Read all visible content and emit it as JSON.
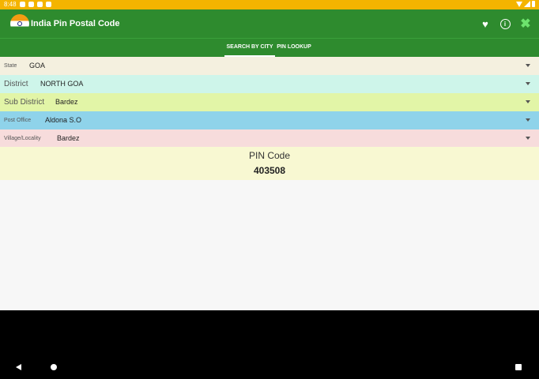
{
  "status_bar": {
    "time": "8:48"
  },
  "app": {
    "title": "India Pin Postal Code",
    "logo_icon": "india-flag-pin-icon",
    "actions": {
      "favorite_icon": "heart-icon",
      "info_icon": "info-icon",
      "close_icon": "close-x-icon"
    }
  },
  "tabs": [
    {
      "label": "SEARCH BY CITY",
      "active": true
    },
    {
      "label": "PIN LOOKUP",
      "active": false
    }
  ],
  "fields": [
    {
      "label": "State",
      "value": "GOA",
      "bg": "#f4f0df"
    },
    {
      "label": "District",
      "value": "NORTH GOA",
      "bg": "#cef5ea"
    },
    {
      "label": "Sub District",
      "value": "Bardez",
      "bg": "#e2f5a7"
    },
    {
      "label": "Post Office",
      "value": "Aldona S.O",
      "bg": "#8fd3ea"
    },
    {
      "label": "Village/Locality",
      "value": "Bardez",
      "bg": "#f7dcdc"
    }
  ],
  "result": {
    "label": "PIN Code",
    "value": "403508"
  },
  "colors": {
    "appbar": "#2e8b2e",
    "status_bar": "#f4b400",
    "close_icon": "#6de36d"
  }
}
